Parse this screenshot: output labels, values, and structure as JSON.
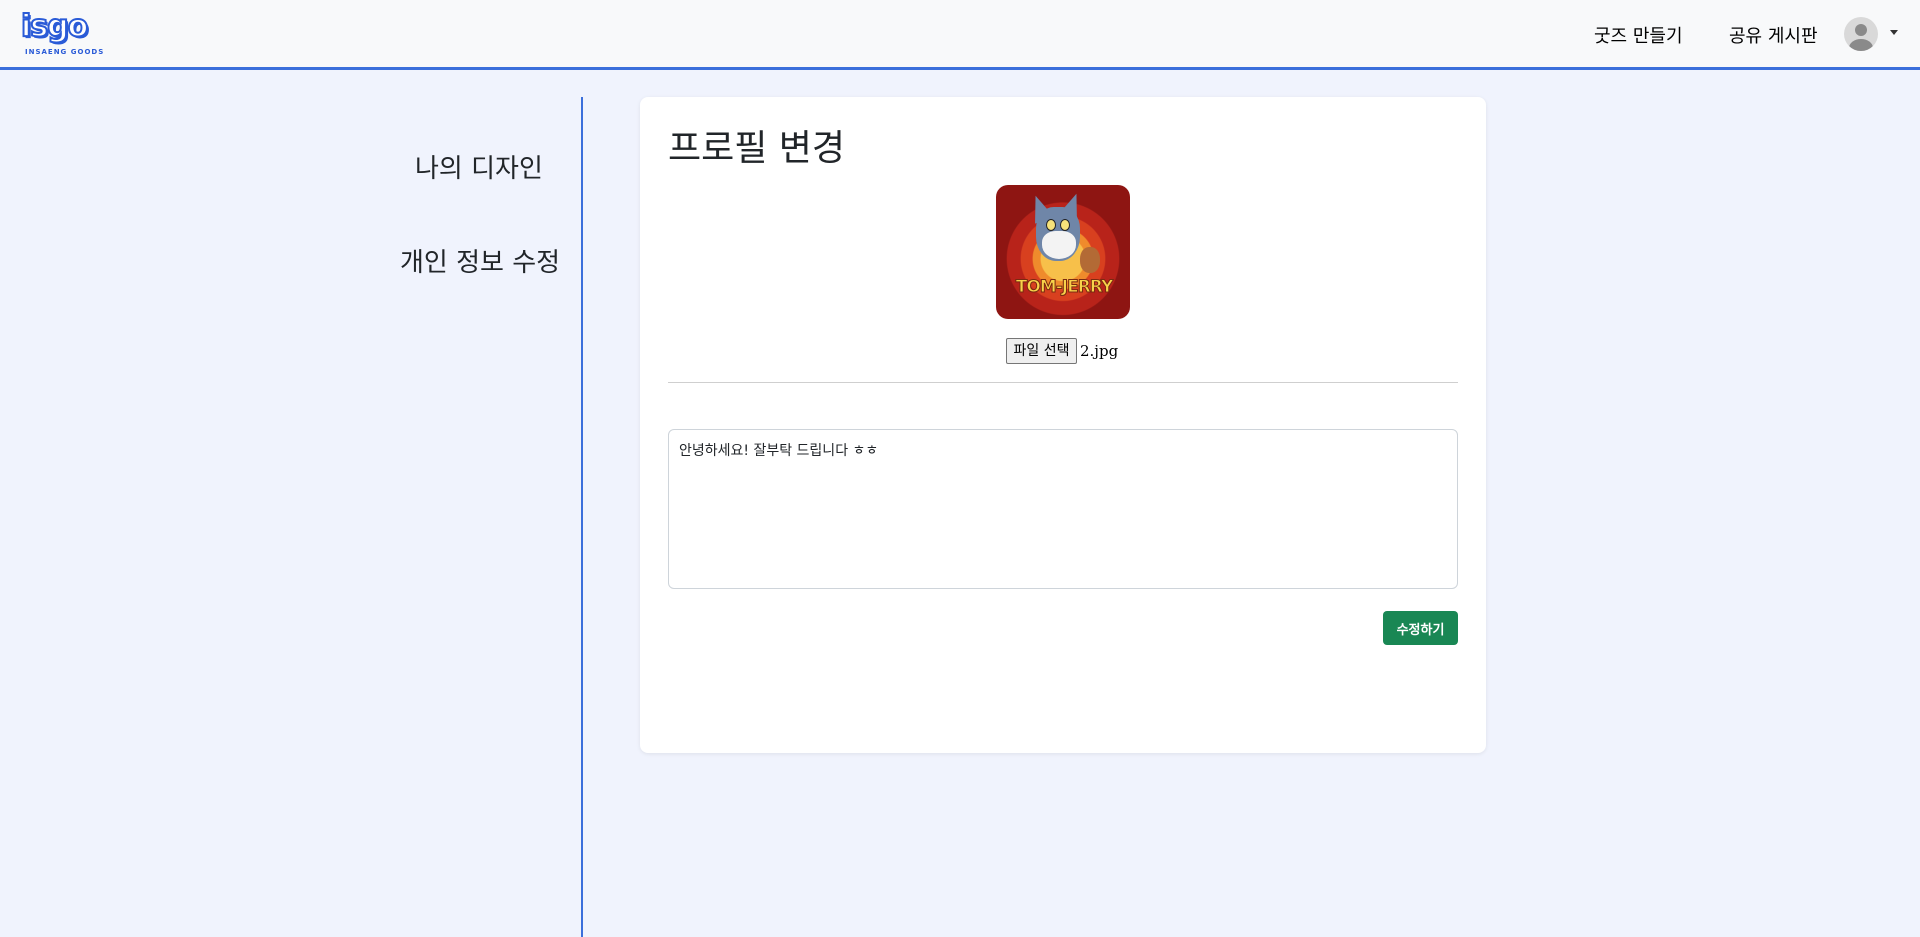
{
  "header": {
    "logo_text": "isgo",
    "logo_subtext": "INSAENG GOODS",
    "nav_make": "굿즈 만들기",
    "nav_board": "공유 게시판",
    "profile_icon": "user-avatar-icon",
    "dropdown_icon": "caret-down-icon"
  },
  "sidebar": {
    "items": [
      {
        "label": "나의 디자인"
      },
      {
        "label": "개인 정보 수정"
      }
    ],
    "accent_color": "#3b6fdb"
  },
  "profile": {
    "title": "프로필 변경",
    "image_caption": "TOM-JERRY",
    "file_button_label": "파일 선택",
    "file_name": "2.jpg",
    "bio_value": "안녕하세요! 잘부탁 드립니다 ㅎㅎ",
    "submit_label": "수정하기"
  },
  "colors": {
    "accent": "#3b6fdb",
    "submit": "#198754",
    "background": "#f0f3fd"
  }
}
